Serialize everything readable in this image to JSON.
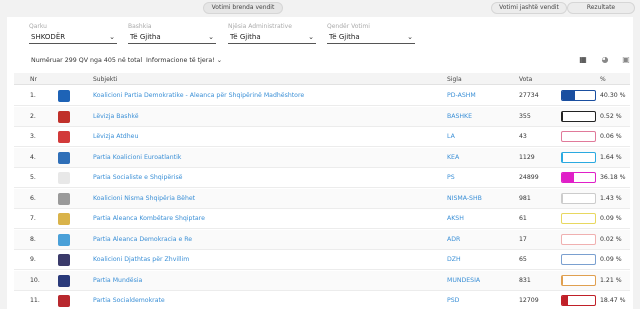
{
  "top": {
    "inside_label": "Votimi brenda vendit",
    "outside_label": "Votimi jashtë vendit",
    "results_label": "Rezultate"
  },
  "filters": [
    {
      "label": "Qarku",
      "value": "SHKODËR"
    },
    {
      "label": "Bashkia",
      "value": "Të Gjitha"
    },
    {
      "label": "Njësia Administrative",
      "value": "Të Gjitha"
    },
    {
      "label": "Qendër Votimi",
      "value": "Të Gjitha"
    }
  ],
  "count_text": "Numëruar 299 QV nga 405 në total",
  "more_info": "Informacione të tjera! ⌄",
  "columns": {
    "nr": "Nr",
    "subject": "Subjekti",
    "sigla": "Sigla",
    "vota": "Vota",
    "pct": "%"
  },
  "rows": [
    {
      "nr": "1.",
      "name": "Koalicioni Partia Demokratike - Aleanca për Shqipërinë Madhështore",
      "sigla": "PD-ASHM",
      "vota": "27734",
      "pct": "40.30 %",
      "share": 0.403,
      "color": "#1a4fa0",
      "logo": "#1e63b6"
    },
    {
      "nr": "2.",
      "name": "Lëvizja Bashkë",
      "sigla": "BASHKE",
      "vota": "355",
      "pct": "0.52 %",
      "share": 0.0052,
      "color": "#222222",
      "logo": "#c0302a"
    },
    {
      "nr": "3.",
      "name": "Lëvizja Atdheu",
      "sigla": "LA",
      "vota": "43",
      "pct": "0.06 %",
      "share": 0.0006,
      "color": "#e07a9a",
      "logo": "#d23a3a"
    },
    {
      "nr": "4.",
      "name": "Partia Koalicioni Euroatlantik",
      "sigla": "KEA",
      "vota": "1129",
      "pct": "1.64 %",
      "share": 0.0164,
      "color": "#2aa9e0",
      "logo": "#2f6fb8"
    },
    {
      "nr": "5.",
      "name": "Partia Socialiste e Shqipërisë",
      "sigla": "PS",
      "vota": "24899",
      "pct": "36.18 %",
      "share": 0.3618,
      "color": "#e020c8",
      "logo": "#e8e8e8"
    },
    {
      "nr": "6.",
      "name": "Koalicioni Nisma Shqipëria Bëhet",
      "sigla": "NISMA-SHB",
      "vota": "981",
      "pct": "1.43 %",
      "share": 0.0143,
      "color": "#cccccc",
      "logo": "#9a9a9a"
    },
    {
      "nr": "7.",
      "name": "Partia Aleanca Kombëtare Shqiptare",
      "sigla": "AKSH",
      "vota": "61",
      "pct": "0.09 %",
      "share": 0.0009,
      "color": "#e8d860",
      "logo": "#d9b34a"
    },
    {
      "nr": "8.",
      "name": "Partia Aleanca Demokracia e Re",
      "sigla": "ADR",
      "vota": "17",
      "pct": "0.02 %",
      "share": 0.0002,
      "color": "#f0b0b0",
      "logo": "#4aa0d8"
    },
    {
      "nr": "9.",
      "name": "Koalicioni Djathtas për Zhvillim",
      "sigla": "DZH",
      "vota": "65",
      "pct": "0.09 %",
      "share": 0.0009,
      "color": "#7aa0d0",
      "logo": "#3a3a6a"
    },
    {
      "nr": "10.",
      "name": "Partia Mundësia",
      "sigla": "MUNDESIA",
      "vota": "831",
      "pct": "1.21 %",
      "share": 0.0121,
      "color": "#e0a050",
      "logo": "#2a3a7a"
    },
    {
      "nr": "11.",
      "name": "Partia Socialdemokrate",
      "sigla": "PSD",
      "vota": "12709",
      "pct": "18.47 %",
      "share": 0.1847,
      "color": "#c02028",
      "logo": "#b8282e"
    }
  ]
}
